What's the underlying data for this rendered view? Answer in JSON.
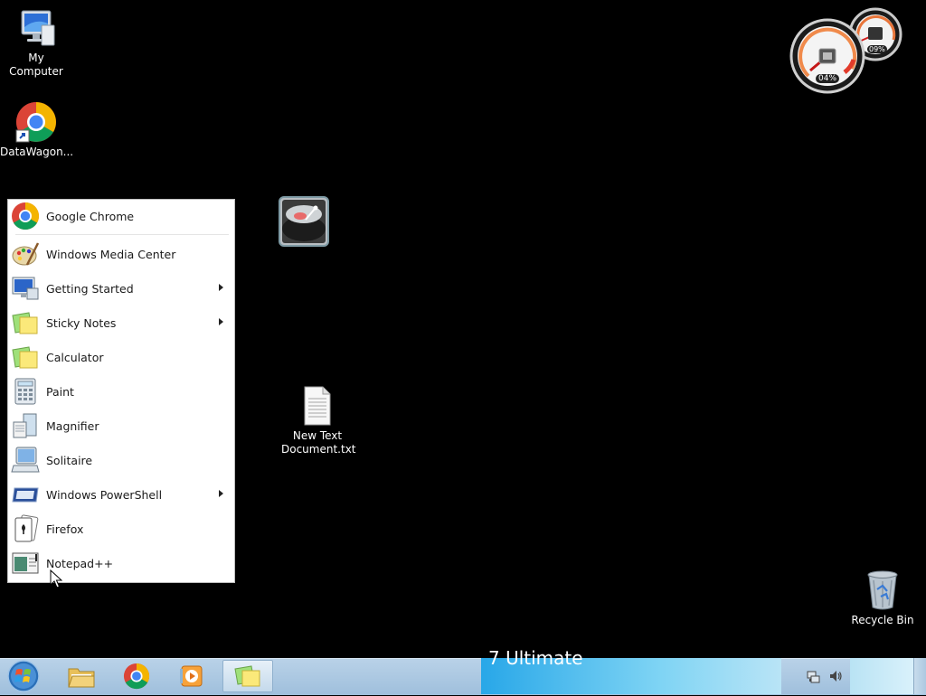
{
  "desktop": {
    "icons": [
      {
        "label": "My Computer",
        "icon": "computer-icon"
      },
      {
        "label": "DataWagon...",
        "icon": "chrome-icon"
      },
      {
        "label": "New Text Document.txt",
        "label_line1": "New Text",
        "label_line2": "Document.txt",
        "icon": "text-file-icon"
      },
      {
        "label": "Recycle Bin",
        "icon": "recycle-bin-icon"
      }
    ]
  },
  "gadget": {
    "cpu_readout": "04%",
    "memory_readout": "09%"
  },
  "menu": {
    "pinned": {
      "label": "Google Chrome",
      "icon": "chrome-icon"
    },
    "items": [
      {
        "label": "Windows Media Center",
        "icon": "paint-palette-icon",
        "submenu": false
      },
      {
        "label": "Getting Started",
        "icon": "monitor-icon",
        "submenu": true
      },
      {
        "label": "Sticky Notes",
        "icon": "sticky-notes-icon",
        "submenu": true
      },
      {
        "label": "Calculator",
        "icon": "sticky-notes-icon",
        "submenu": false
      },
      {
        "label": "Paint",
        "icon": "calculator-icon",
        "submenu": false
      },
      {
        "label": "Magnifier",
        "icon": "document-icon",
        "submenu": false
      },
      {
        "label": "Solitaire",
        "icon": "computer-icon",
        "submenu": false
      },
      {
        "label": "Windows PowerShell",
        "icon": "powershell-icon",
        "submenu": true
      },
      {
        "label": "Firefox",
        "icon": "playing-card-icon",
        "submenu": false
      },
      {
        "label": "Notepad++",
        "icon": "notepad-window-icon",
        "submenu": false
      }
    ]
  },
  "taskbar": {
    "wallpaper_text": "7 Ultimate"
  },
  "colors": {
    "taskbar": "#a9c7e1",
    "menu_bg": "#ffffff",
    "desktop_bg": "#000000"
  }
}
